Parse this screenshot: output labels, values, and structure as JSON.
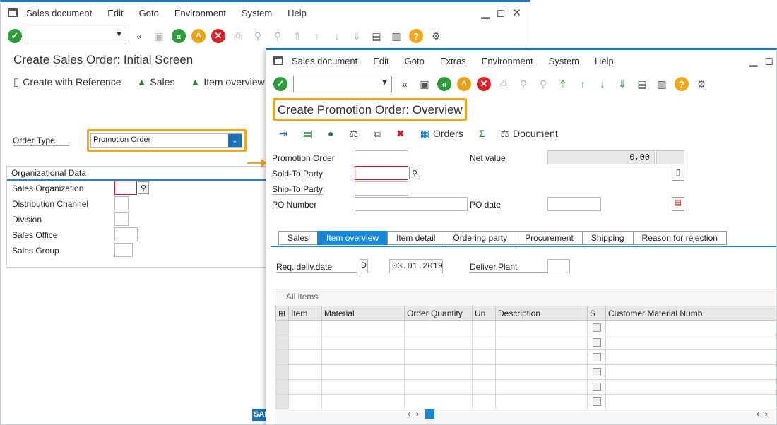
{
  "win1": {
    "menu": [
      "Sales document",
      "Edit",
      "Goto",
      "Environment",
      "System",
      "Help"
    ],
    "title": "Create Sales Order: Initial Screen",
    "app_toolbar": {
      "create_ref": "Create with Reference",
      "sales": "Sales",
      "item_overview": "Item overview"
    },
    "order_type_label": "Order Type",
    "order_type_value": "Promotion Order",
    "org_section": "Organizational Data",
    "org_fields": [
      "Sales Organization",
      "Distribution Channel",
      "Division",
      "Sales Office",
      "Sales Group"
    ],
    "sap_logo": "SAP"
  },
  "win2": {
    "menu": [
      "Sales document",
      "Edit",
      "Goto",
      "Extras",
      "Environment",
      "System",
      "Help"
    ],
    "title": "Create Promotion Order: Overview",
    "app_toolbar": {
      "orders": "Orders",
      "document": "Document"
    },
    "fields": {
      "promotion_order": "Promotion Order",
      "sold_to": "Sold-To Party",
      "ship_to": "Ship-To Party",
      "po_number": "PO Number",
      "net_value": "Net value",
      "net_value_amount": "0,00",
      "po_date": "PO date"
    },
    "tabs": [
      "Sales",
      "Item overview",
      "Item detail",
      "Ordering party",
      "Procurement",
      "Shipping",
      "Reason for rejection"
    ],
    "active_tab": "Item overview",
    "req_deliv_label": "Req. deliv.date",
    "req_deliv_fmt": "D",
    "req_deliv_value": "03.01.2019",
    "deliver_plant_label": "Deliver.Plant",
    "all_items": "All items",
    "columns": [
      "Item",
      "Material",
      "Order Quantity",
      "Un",
      "Description",
      "S",
      "Customer Material Numb"
    ]
  },
  "colors": {
    "accent": "#1a73b8",
    "highlight": "#f0a81c",
    "tab_active": "#1a88d8"
  }
}
